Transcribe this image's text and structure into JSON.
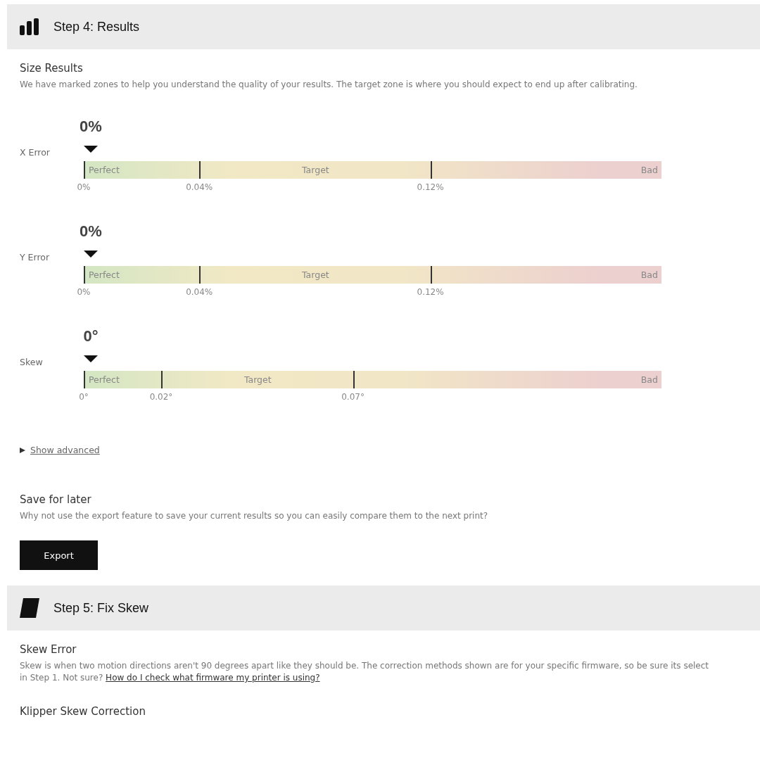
{
  "sections": [
    {
      "kind": "results",
      "title": "Step 4: Results",
      "heading": "Size Results",
      "description": "We have marked zones to help you understand the quality of your results. The target zone is where you should expect to end up after calibrating.",
      "meters": [
        {
          "label": "X Error",
          "value": "0%",
          "level": 0,
          "zones": [
            {
              "label": "Perfect",
              "level": 0.2
            },
            {
              "label": "Target",
              "level": 0.4
            },
            {
              "label": "Bad",
              "level": 0.4
            }
          ],
          "ticks": [
            "0%",
            "0.04%",
            "0.12%"
          ]
        },
        {
          "label": "Y Error",
          "value": "0%",
          "level": 0,
          "zones": [
            {
              "label": "Perfect",
              "level": 0.2
            },
            {
              "label": "Target",
              "level": 0.4
            },
            {
              "label": "Bad",
              "level": 0.4
            }
          ],
          "ticks": [
            "0%",
            "0.04%",
            "0.12%"
          ]
        },
        {
          "label": "Skew",
          "value": "0°",
          "level": 0,
          "zones": [
            {
              "label": "Perfect",
              "level": 0.134
            },
            {
              "label": "Target",
              "level": 0.332
            },
            {
              "label": "Bad",
              "level": 0.534
            }
          ],
          "ticks": [
            "0°",
            "0.02°",
            "0.07°"
          ]
        }
      ],
      "advanced": {
        "label": "Show advanced",
        "expanded": false
      },
      "save": {
        "heading": "Save for later",
        "text": "Why not use the export feature to save your current results so you can easily compare them to the next print?",
        "button": "Export"
      }
    },
    {
      "kind": "skew",
      "title": "Step 5: Fix Skew",
      "heading": "Skew Error",
      "line_1": "Skew is when two motion directions aren't 90 degrees apart like they should be. The correction methods shown are for your specific firmware, so be sure its select",
      "line_2": "in Step 1. Not sure?",
      "link": "How do I check what firmware my printer is using?",
      "subheading": "Klipper Skew Correction"
    }
  ]
}
